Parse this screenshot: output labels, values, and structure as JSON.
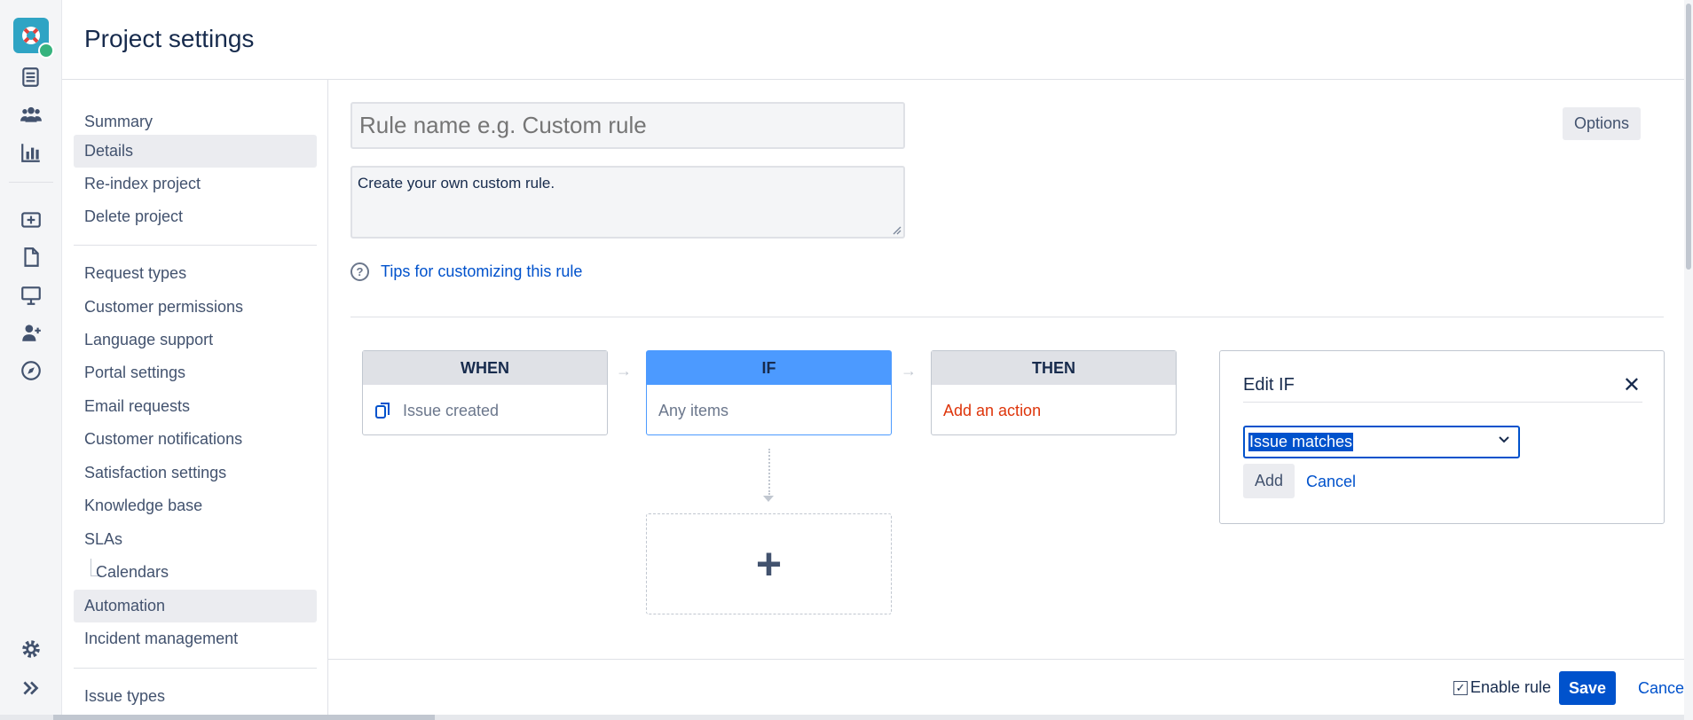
{
  "header": {
    "title": "Project settings"
  },
  "rail": {
    "icons": [
      "app-logo-icon",
      "queues-icon",
      "customers-icon",
      "reports-icon",
      "raise-request-icon",
      "pages-icon",
      "customer-portal-icon",
      "invite-team-icon",
      "explore-icon",
      "settings-icon",
      "expand-icon"
    ]
  },
  "settings_nav": {
    "items": [
      {
        "label": "Summary"
      },
      {
        "label": "Details"
      },
      {
        "label": "Re-index project"
      },
      {
        "label": "Delete project"
      },
      {
        "label": "Request types"
      },
      {
        "label": "Customer permissions"
      },
      {
        "label": "Language support"
      },
      {
        "label": "Portal settings"
      },
      {
        "label": "Email requests"
      },
      {
        "label": "Customer notifications"
      },
      {
        "label": "Satisfaction settings"
      },
      {
        "label": "Knowledge base"
      },
      {
        "label": "SLAs"
      },
      {
        "label": "Calendars"
      },
      {
        "label": "Automation"
      },
      {
        "label": "Incident management"
      },
      {
        "label": "Issue types"
      }
    ],
    "active": [
      "Details",
      "Automation"
    ]
  },
  "rule": {
    "name_placeholder": "Rule name e.g. Custom rule",
    "description": "Create your own custom rule.",
    "options_label": "Options",
    "tips_label": "Tips for customizing this rule"
  },
  "flow": {
    "when": {
      "label": "WHEN",
      "value": "Issue created"
    },
    "if": {
      "label": "IF",
      "value": "Any items"
    },
    "then": {
      "label": "THEN",
      "value": "Add an action"
    },
    "add_symbol": "+"
  },
  "edit_panel": {
    "title": "Edit IF",
    "select_value": "Issue matches",
    "add_label": "Add",
    "cancel_label": "Cancel"
  },
  "footer": {
    "enable_label": "Enable rule",
    "enable_checked": true,
    "save_label": "Save",
    "cancel_label": "Cancel"
  },
  "colors": {
    "primary": "#0052cc",
    "selected_block": "#4c9aff",
    "danger": "#de350b"
  }
}
